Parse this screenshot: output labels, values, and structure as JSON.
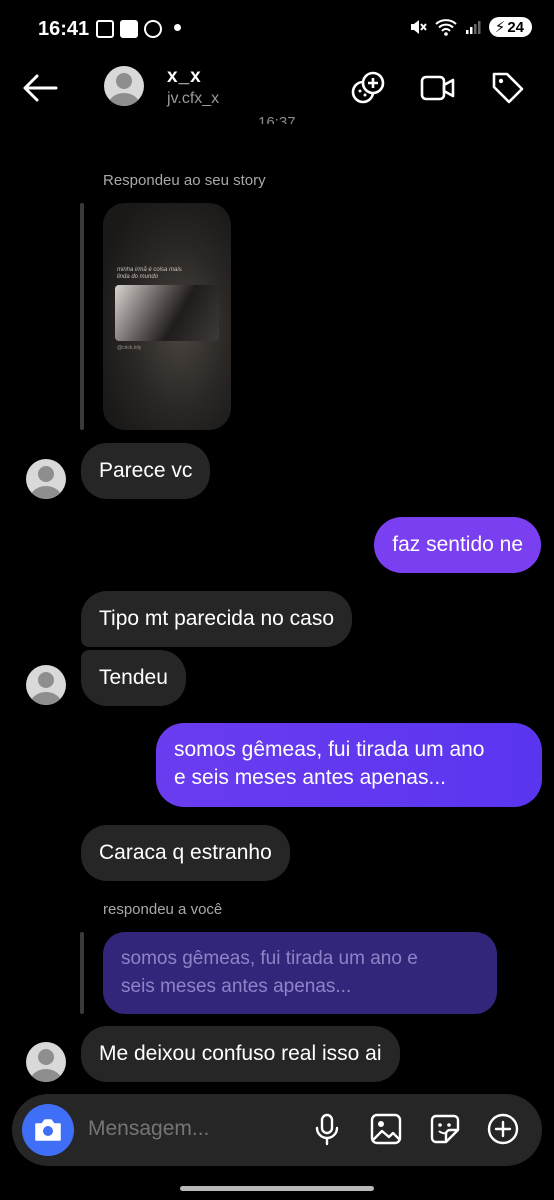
{
  "status_bar": {
    "time": "16:41",
    "battery": "24"
  },
  "header": {
    "name": "x_x",
    "username": "jv.cfx_x",
    "timestamp": "16:37"
  },
  "story_reply": {
    "label": "Respondeu ao seu story",
    "caption": "minha irmã é coisa mais linda do mundo",
    "handle": "@crick.loly"
  },
  "messages": [
    {
      "id": "m1",
      "text": "Parece vc",
      "side": "in"
    },
    {
      "id": "m2",
      "text": "faz sentido ne",
      "side": "out"
    },
    {
      "id": "m3",
      "text": "Tipo mt parecida no caso",
      "side": "in"
    },
    {
      "id": "m4",
      "text": "Tendeu",
      "side": "in"
    },
    {
      "id": "m5",
      "lines": [
        "somos gêmeas, fui tirada um ano",
        "e seis meses antes apenas..."
      ],
      "side": "out"
    },
    {
      "id": "m6",
      "text": "Caraca q estranho",
      "side": "in"
    },
    {
      "id": "m7",
      "text": "Me deixou confuso real isso ai",
      "side": "in"
    }
  ],
  "reply_to_you": {
    "label": "respondeu a você",
    "quoted_lines": [
      "somos gêmeas, fui tirada um ano e",
      "seis meses antes apenas..."
    ]
  },
  "composer": {
    "placeholder": "Mensagem..."
  },
  "colors": {
    "outgoing": "#7b3ff2",
    "incoming": "#262626",
    "camera": "#3f6ff6"
  }
}
